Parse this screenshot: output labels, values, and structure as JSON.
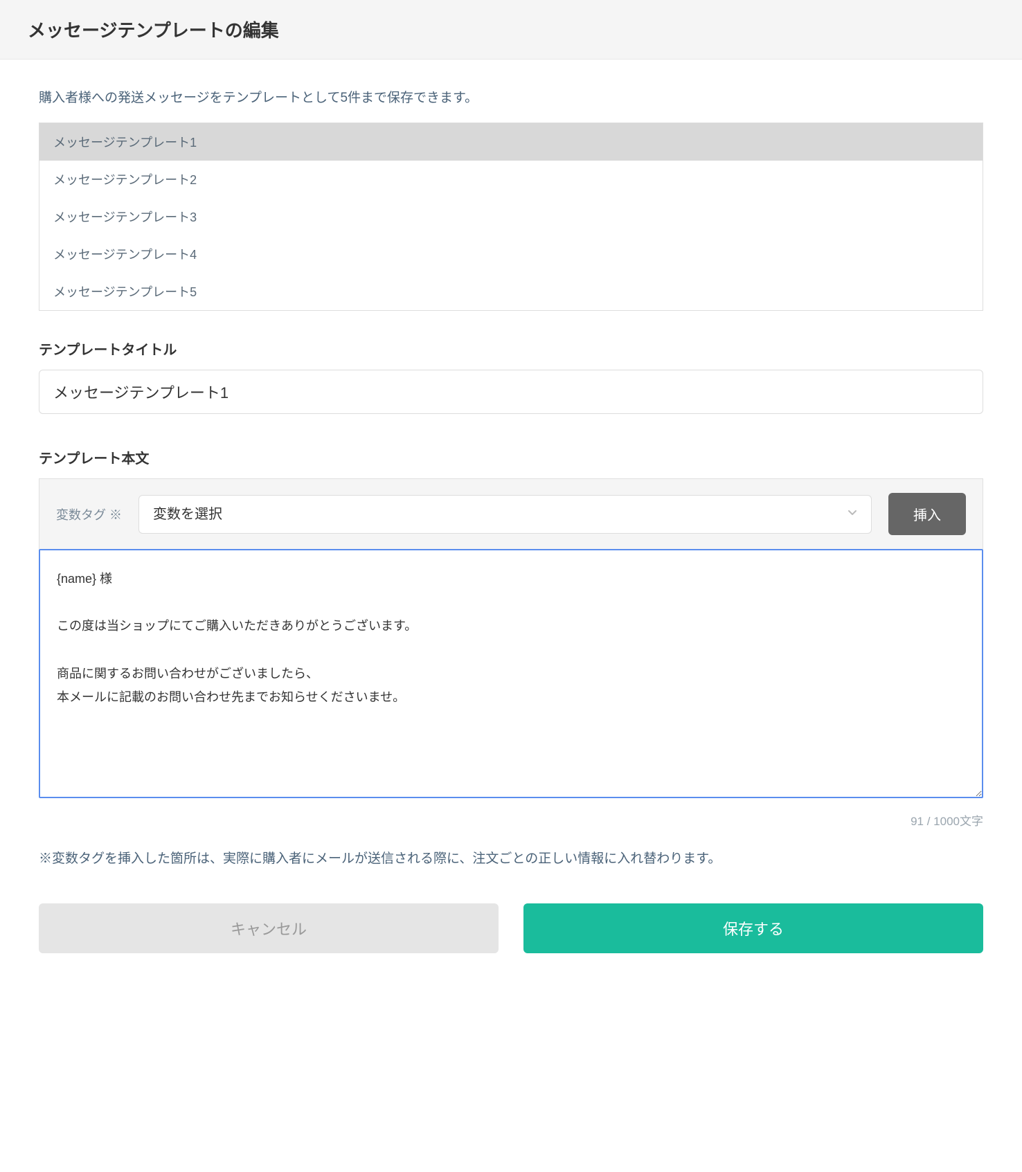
{
  "header": {
    "title": "メッセージテンプレートの編集"
  },
  "description": "購入者様への発送メッセージをテンプレートとして5件まで保存できます。",
  "template_list": {
    "items": [
      {
        "label": "メッセージテンプレート1",
        "selected": true
      },
      {
        "label": "メッセージテンプレート2",
        "selected": false
      },
      {
        "label": "メッセージテンプレート3",
        "selected": false
      },
      {
        "label": "メッセージテンプレート4",
        "selected": false
      },
      {
        "label": "メッセージテンプレート5",
        "selected": false
      }
    ]
  },
  "title_section": {
    "label": "テンプレートタイトル",
    "value": "メッセージテンプレート1"
  },
  "body_section": {
    "label": "テンプレート本文",
    "variable_tag_label": "変数タグ ※",
    "variable_select_placeholder": "変数を選択",
    "insert_button_label": "挿入",
    "textarea_value": "{name} 様\n\nこの度は当ショップにてご購入いただきありがとうございます。\n\n商品に関するお問い合わせがございましたら、\n本メールに記載のお問い合わせ先までお知らせくださいませ。",
    "char_count": "91 / 1000文字"
  },
  "note": "※変数タグを挿入した箇所は、実際に購入者にメールが送信される際に、注文ごとの正しい情報に入れ替わります。",
  "buttons": {
    "cancel": "キャンセル",
    "save": "保存する"
  }
}
